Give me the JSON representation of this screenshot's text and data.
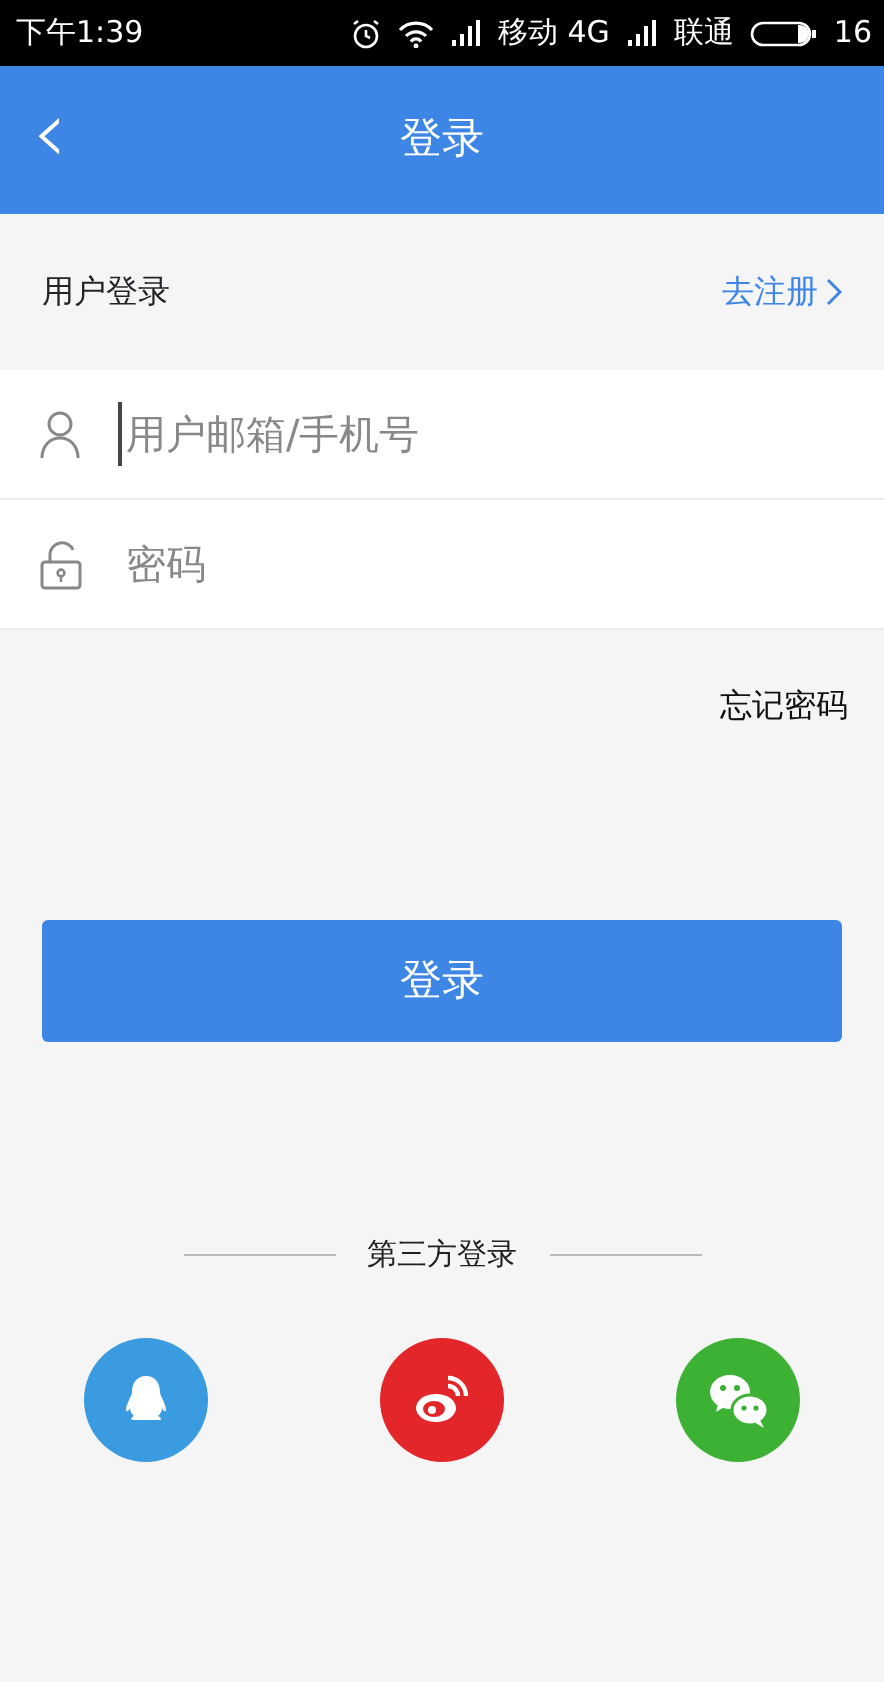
{
  "status_bar": {
    "time": "下午1:39",
    "carrier_1": "移动 4G",
    "carrier_2": "联通",
    "battery": "16"
  },
  "header": {
    "back": "‹",
    "title": "登录"
  },
  "section": {
    "title": "用户登录",
    "register_link": "去注册"
  },
  "fields": [
    {
      "kind": "user",
      "placeholder": "用户邮箱/手机号",
      "focused": true
    },
    {
      "kind": "lock",
      "placeholder": "密码",
      "focused": false
    }
  ],
  "forgot_link": "忘记密码",
  "login_button": "登录",
  "third_party": {
    "title": "第三方登录",
    "providers": [
      {
        "kind": "qq",
        "color": "#3a9be0"
      },
      {
        "kind": "weibo",
        "color": "#e2262a"
      },
      {
        "kind": "wechat",
        "color": "#3db134"
      }
    ]
  }
}
